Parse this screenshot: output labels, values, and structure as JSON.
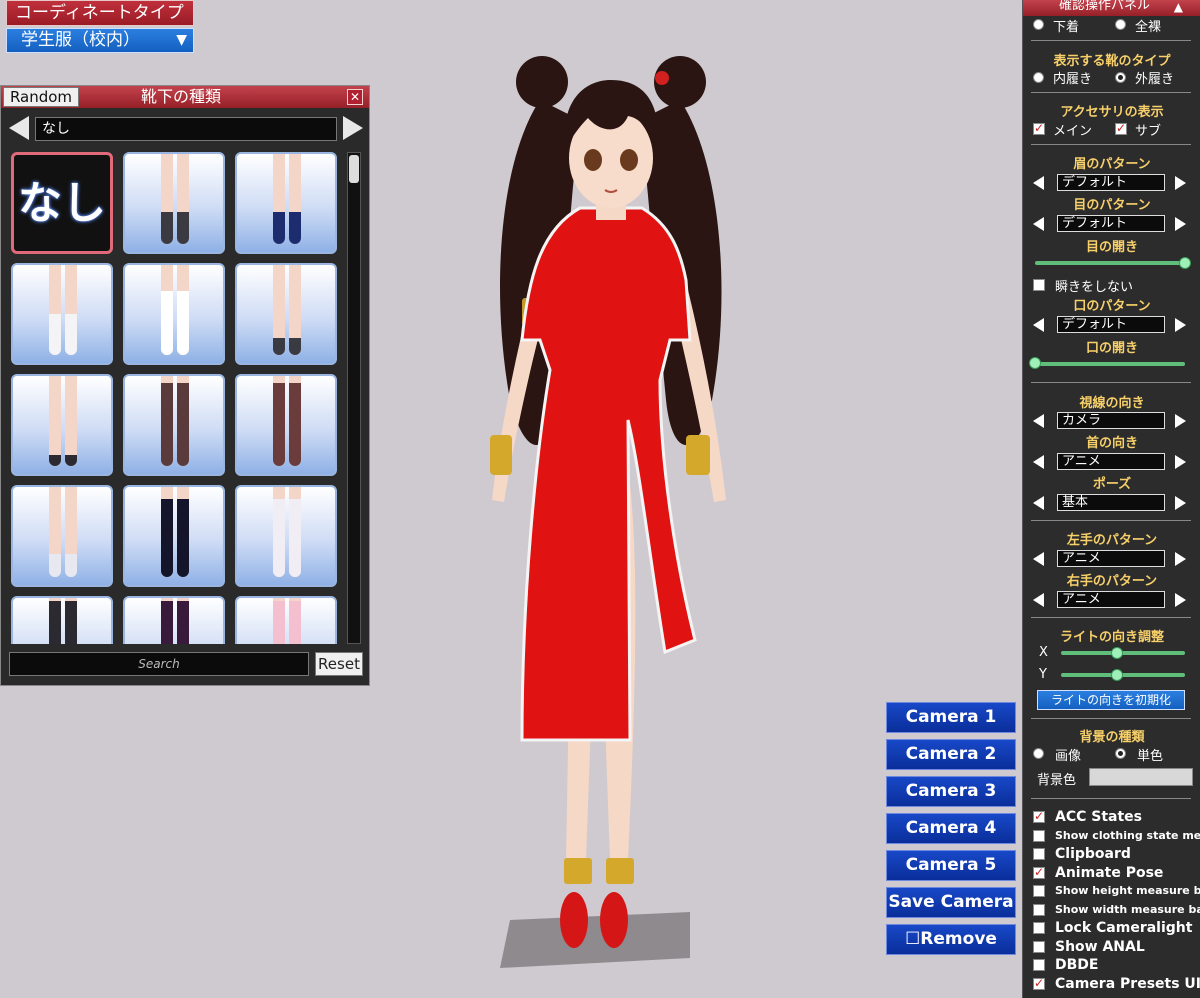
{
  "coordinate": {
    "title": "コーディネートタイプ",
    "selected": "学生服（校内）",
    "dropdown_icon": "triangle-down-icon"
  },
  "sock_panel": {
    "random_label": "Random",
    "title": "靴下の種類",
    "close_icon": "close-icon",
    "current_value": "なし",
    "none_label": "なし",
    "search_placeholder": "Search",
    "reset_label": "Reset",
    "items": [
      {
        "kind": "none"
      },
      {
        "sock": "#3a3a40",
        "sock_h": 0.35
      },
      {
        "sock": "#1c2c6e",
        "sock_h": 0.35
      },
      {
        "sock": "#f4f4f6",
        "sock_h": 0.45
      },
      {
        "sock": "#ffffff",
        "sock_h": 0.7
      },
      {
        "sock": "#3a3a42",
        "sock_h": 0.18
      },
      {
        "sock": "#2a2a30",
        "sock_h": 0.12
      },
      {
        "sock": "#5a3a3a",
        "sock_h": 0.9
      },
      {
        "sock": "#6a3c3c",
        "sock_h": 0.9
      },
      {
        "sock": "#e8e8f0",
        "sock_h": 0.25
      },
      {
        "sock": "#14142a",
        "sock_h": 0.85
      },
      {
        "sock": "#f0eef4",
        "sock_h": 0.85
      },
      {
        "sock": "#2a2a30",
        "sock_h": 0.95
      },
      {
        "sock": "#3a1a3a",
        "sock_h": 0.95
      },
      {
        "sock": "#f4c0d0",
        "sock_h": 0.95
      }
    ]
  },
  "cameras": [
    "Camera 1",
    "Camera 2",
    "Camera 3",
    "Camera 4",
    "Camera 5",
    "Save Camera",
    "☐Remove"
  ],
  "right_panel": {
    "title": "確認操作パネル",
    "collapse_icon": "triangle-up-icon",
    "underwear": "下着",
    "nude": "全裸",
    "shoe_type_head": "表示する靴のタイプ",
    "indoor": "内履き",
    "outdoor": "外履き",
    "acc_head": "アクセサリの表示",
    "acc_main": "メイン",
    "acc_sub": "サブ",
    "eyebrow_head": "眉のパターン",
    "eyebrow_value": "デフォルト",
    "eye_head": "目のパターン",
    "eye_value": "デフォルト",
    "eye_open_head": "目の開き",
    "eye_open": 1.0,
    "no_blink": "瞬きをしない",
    "mouth_head": "口のパターン",
    "mouth_value": "デフォルト",
    "mouth_open_head": "口の開き",
    "mouth_open": 0.0,
    "gaze_head": "視線の向き",
    "gaze_value": "カメラ",
    "neck_head": "首の向き",
    "neck_value": "アニメ",
    "pose_head": "ポーズ",
    "pose_value": "基本",
    "lhand_head": "左手のパターン",
    "lhand_value": "アニメ",
    "rhand_head": "右手のパターン",
    "rhand_value": "アニメ",
    "light_head": "ライトの向き調整",
    "light_x_label": "X",
    "light_y_label": "Y",
    "light_x": 0.45,
    "light_y": 0.45,
    "light_reset": "ライトの向きを初期化",
    "bg_head": "背景の種類",
    "bg_image": "画像",
    "bg_solid": "単色",
    "bg_color_label": "背景色",
    "bg_color": "#d8d8d8",
    "options": [
      {
        "label": "ACC States",
        "checked": true,
        "size": "big"
      },
      {
        "label": "Show clothing state menu",
        "checked": false,
        "size": "small"
      },
      {
        "label": "Clipboard",
        "checked": false,
        "size": "big"
      },
      {
        "label": "Animate Pose",
        "checked": true,
        "size": "big"
      },
      {
        "label": "Show height measure bar",
        "checked": false,
        "size": "small"
      },
      {
        "label": "Show width measure bar",
        "checked": false,
        "size": "small"
      },
      {
        "label": "Lock Cameralight",
        "checked": false,
        "size": "big"
      },
      {
        "label": "Show ANAL",
        "checked": false,
        "size": "big"
      },
      {
        "label": "DBDE",
        "checked": false,
        "size": "big"
      },
      {
        "label": "Camera Presets UI",
        "checked": true,
        "size": "big"
      }
    ]
  }
}
